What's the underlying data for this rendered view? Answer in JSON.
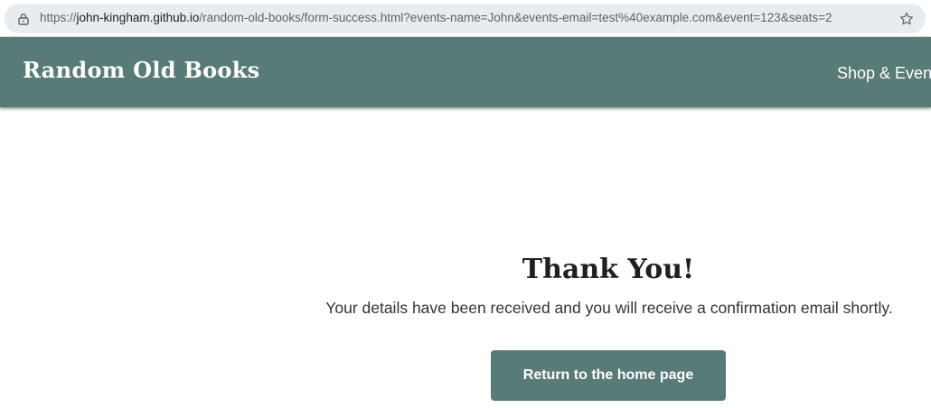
{
  "browser": {
    "url_prefix": "https://",
    "url_host": "john-kingham.github.io",
    "url_path": "/random-old-books/form-success.html?events-name=John&events-email=test%40example.com&event=123&seats=2",
    "lock_icon": "lock-icon",
    "bookmark_icon": "star-icon"
  },
  "header": {
    "logo": "Random Old Books",
    "nav_link": "Shop & Even",
    "background_color": "#587b77"
  },
  "main": {
    "heading": "Thank You!",
    "message": "Your details have been received and you will receive a confirmation email shortly.",
    "button_label": "Return to the home page",
    "button_color": "#587b77"
  }
}
